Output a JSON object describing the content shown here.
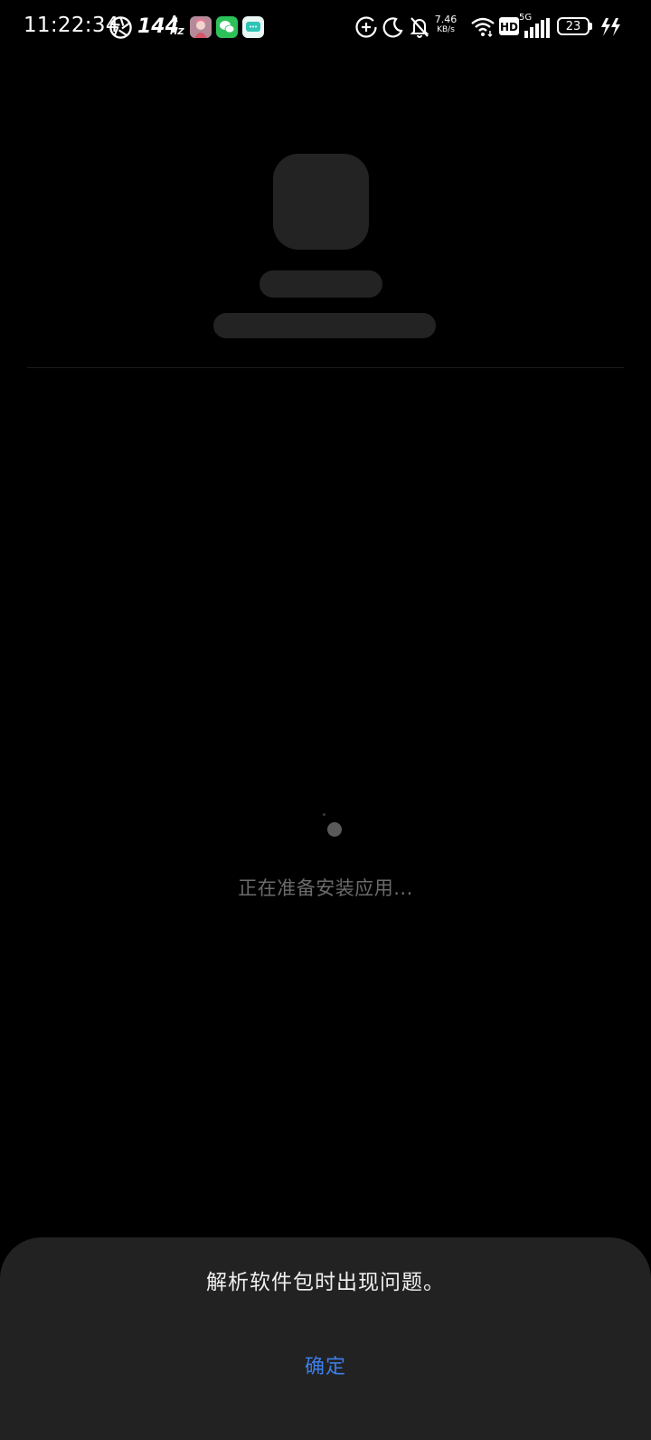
{
  "status_bar": {
    "time": "11:22:34",
    "refresh_rate": "144",
    "refresh_unit": "HZ",
    "refresh_mode": "A",
    "net_speed_value": "7.46",
    "net_speed_unit": "KB/s",
    "network_type": "5G",
    "battery_level": "23",
    "icons": [
      "aperture-icon",
      "app-avatar-icon",
      "wechat-icon",
      "message-icon",
      "data-saver-icon",
      "moon-icon",
      "bell-off-icon",
      "wifi-icon",
      "hd-icon",
      "signal-icon",
      "battery-icon",
      "charging-icon"
    ]
  },
  "loading": {
    "text": "正在准备安装应用..."
  },
  "dialog": {
    "message": "解析软件包时出现问题。",
    "ok_label": "确定",
    "accent_color": "#3c7ee8"
  }
}
